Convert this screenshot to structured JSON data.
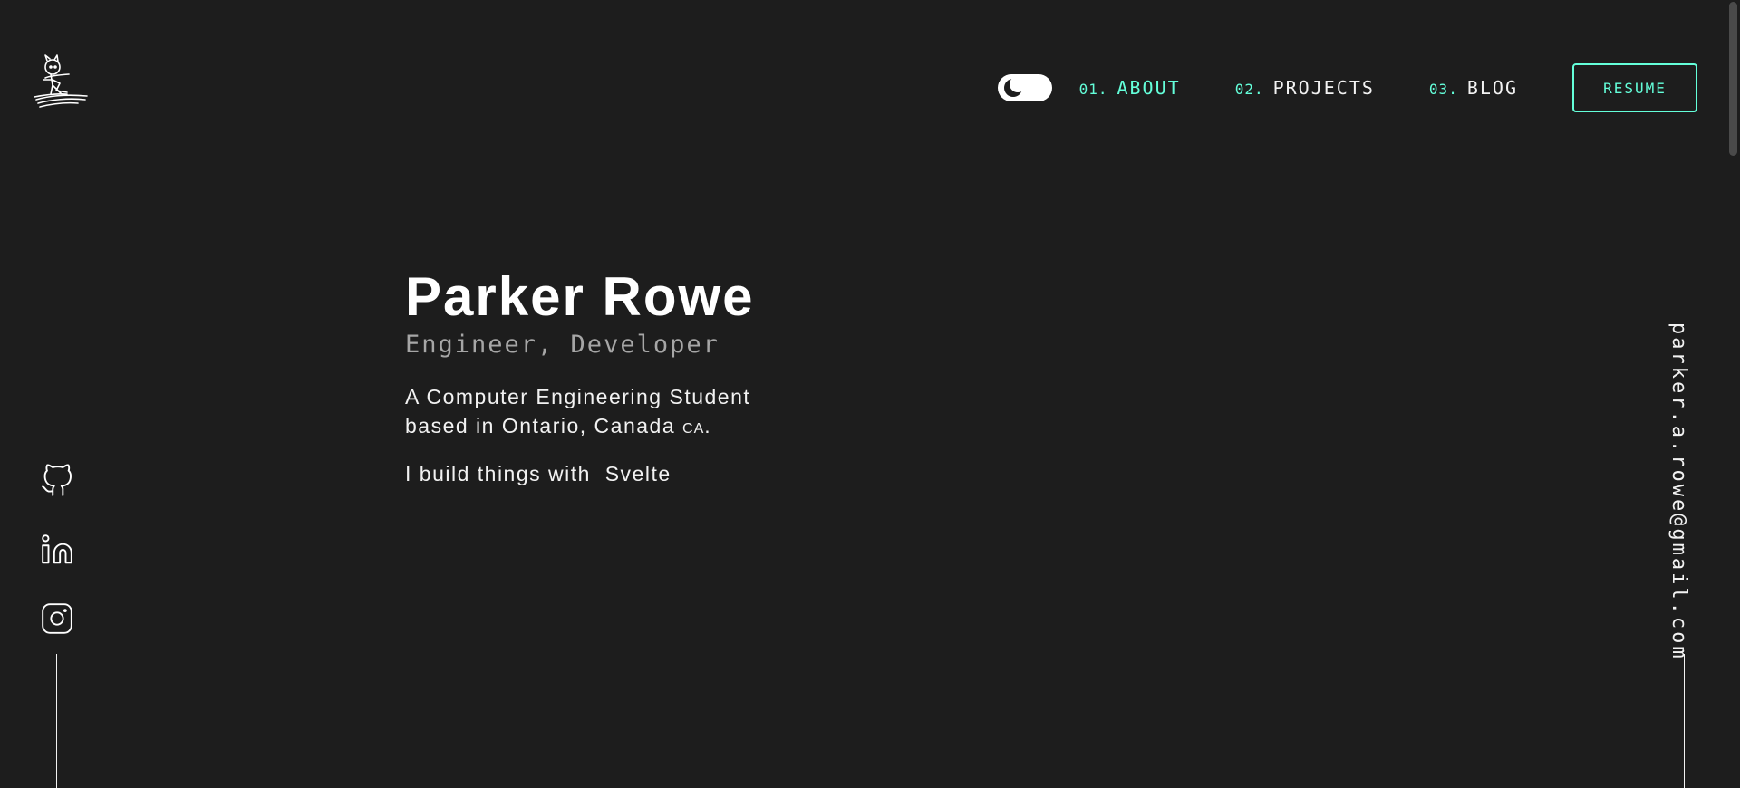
{
  "logo": {
    "icon": "stick-figure-logo-icon"
  },
  "header": {
    "theme_toggle": {
      "icon": "moon-icon",
      "state": "dark"
    },
    "nav": [
      {
        "num": "01.",
        "label": "ABOUT",
        "active": true
      },
      {
        "num": "02.",
        "label": "PROJECTS",
        "active": false
      },
      {
        "num": "03.",
        "label": "BLOG",
        "active": false
      }
    ],
    "resume_label": "RESUME"
  },
  "hero": {
    "name": "Parker Rowe",
    "subtitle": "Engineer, Developer",
    "bio_line1": "A Computer Engineering Student",
    "bio_line2": "based in Ontario, Canada",
    "country_code": "CA",
    "period": ".",
    "build_text": "I build things with",
    "build_tech": "Svelte"
  },
  "social": [
    {
      "icon": "github-icon"
    },
    {
      "icon": "linkedin-icon"
    },
    {
      "icon": "instagram-icon"
    }
  ],
  "email": "parker.a.rowe@gmail.com",
  "colors": {
    "background": "#1d1d1d",
    "accent": "#64ffda",
    "text": "#f2f2f2",
    "muted": "#a6a6a6"
  }
}
